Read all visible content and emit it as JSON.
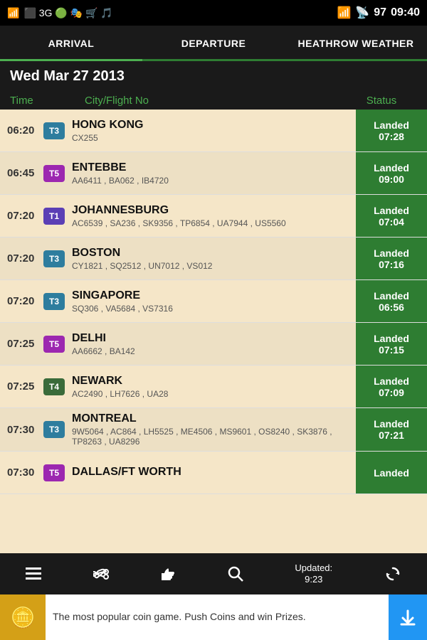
{
  "statusBar": {
    "time": "09:40",
    "battery": "97"
  },
  "tabs": [
    {
      "id": "arrival",
      "label": "ARRIVAL",
      "active": true
    },
    {
      "id": "departure",
      "label": "DEPARTURE",
      "active": false
    },
    {
      "id": "weather",
      "label": "HEATHROW WEATHER",
      "active": false
    }
  ],
  "dateHeader": "Wed Mar 27 2013",
  "columnHeaders": {
    "time": "Time",
    "cityFlight": "City/Flight No",
    "status": "Status"
  },
  "flights": [
    {
      "time": "06:20",
      "terminal": "T3",
      "terminalClass": "t3",
      "city": "HONG KONG",
      "flightNos": "CX255",
      "statusLine1": "Landed",
      "statusLine2": "07:28"
    },
    {
      "time": "06:45",
      "terminal": "T5",
      "terminalClass": "t5",
      "city": "ENTEBBE",
      "flightNos": "AA6411 , BA062 , IB4720",
      "statusLine1": "Landed",
      "statusLine2": "09:00"
    },
    {
      "time": "07:20",
      "terminal": "T1",
      "terminalClass": "t1",
      "city": "JOHANNESBURG",
      "flightNos": "AC6539 , SA236 , SK9356 , TP6854 , UA7944 , US5560",
      "statusLine1": "Landed",
      "statusLine2": "07:04"
    },
    {
      "time": "07:20",
      "terminal": "T3",
      "terminalClass": "t3",
      "city": "BOSTON",
      "flightNos": "CY1821 , SQ2512 , UN7012 , VS012",
      "statusLine1": "Landed",
      "statusLine2": "07:16"
    },
    {
      "time": "07:20",
      "terminal": "T3",
      "terminalClass": "t3",
      "city": "SINGAPORE",
      "flightNos": "SQ306 , VA5684 , VS7316",
      "statusLine1": "Landed",
      "statusLine2": "06:56"
    },
    {
      "time": "07:25",
      "terminal": "T5",
      "terminalClass": "t5",
      "city": "DELHI",
      "flightNos": "AA6662 , BA142",
      "statusLine1": "Landed",
      "statusLine2": "07:15"
    },
    {
      "time": "07:25",
      "terminal": "T4",
      "terminalClass": "t4",
      "city": "NEWARK",
      "flightNos": "AC2490 , LH7626 , UA28",
      "statusLine1": "Landed",
      "statusLine2": "07:09"
    },
    {
      "time": "07:30",
      "terminal": "T3",
      "terminalClass": "t3",
      "city": "MONTREAL",
      "flightNos": "9W5064 , AC864 , LH5525 , ME4506 , MS9601 , OS8240 , SK3876 , TP8263 , UA8296",
      "statusLine1": "Landed",
      "statusLine2": "07:21"
    },
    {
      "time": "07:30",
      "terminal": "T5",
      "terminalClass": "t5",
      "city": "DALLAS/FT WORTH",
      "flightNos": "",
      "statusLine1": "Landed",
      "statusLine2": ""
    }
  ],
  "toolbar": {
    "updated_label": "Updated:",
    "updated_time": "9:23"
  },
  "ad": {
    "text": "The most popular coin game. Push Coins and win Prizes."
  }
}
